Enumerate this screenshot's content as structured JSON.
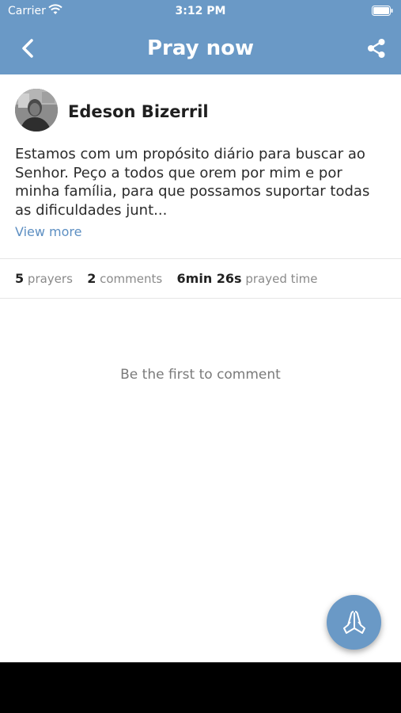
{
  "status": {
    "carrier": "Carrier",
    "time": "3:12 PM"
  },
  "header": {
    "title": "Pray now"
  },
  "post": {
    "author": "Edeson Bizerril",
    "body": "Estamos com um propósito diário para buscar ao Senhor. Peço a todos que orem por mim e por minha família, para que possamos suportar todas as dificuldades junt...",
    "view_more": "View more"
  },
  "stats": {
    "prayers_count": "5",
    "prayers_label": "prayers",
    "comments_count": "2",
    "comments_label": "comments",
    "time_value": "6min 26s",
    "time_label": "prayed time"
  },
  "comments": {
    "empty_text": "Be the first to comment"
  },
  "colors": {
    "accent": "#6a99c6",
    "link": "#5d8fc2"
  },
  "icons": [
    "wifi-icon",
    "battery-icon",
    "back-icon",
    "share-icon",
    "praying-hands-icon"
  ]
}
